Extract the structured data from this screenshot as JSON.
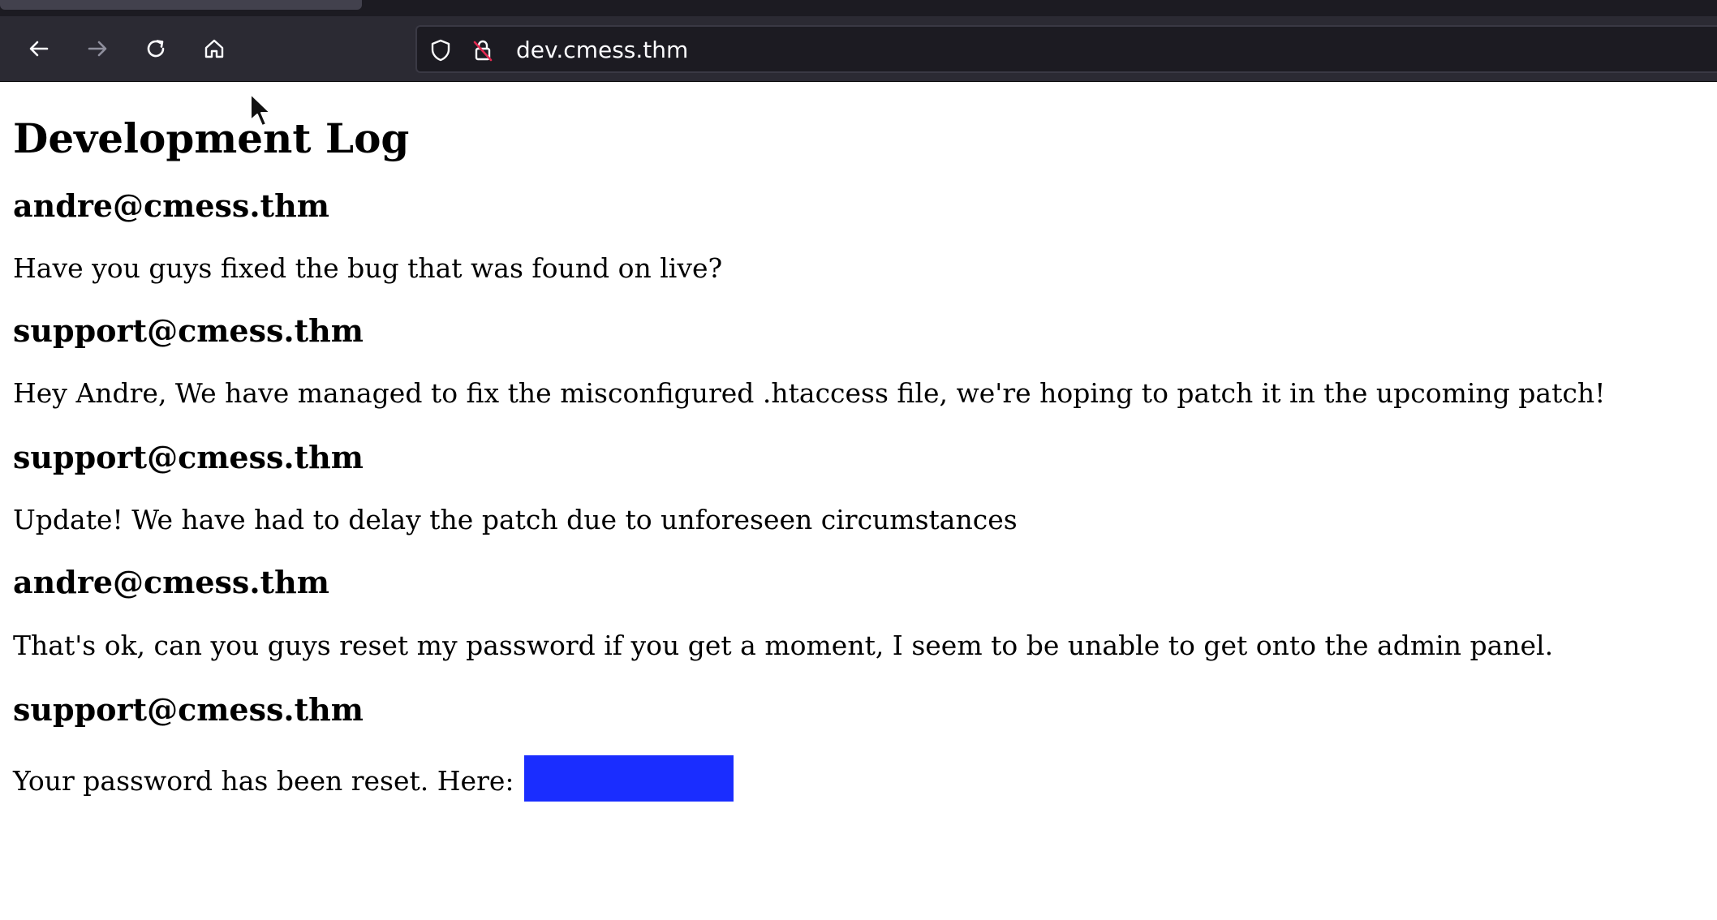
{
  "browser": {
    "url": "dev.cmess.thm",
    "nav_icons": [
      "back-arrow-icon",
      "forward-arrow-icon",
      "reload-icon",
      "home-icon"
    ],
    "url_icons": [
      "tracking-shield-icon",
      "insecure-lock-icon"
    ]
  },
  "page": {
    "title": "Development Log",
    "entries": [
      {
        "author": "andre@cmess.thm",
        "message": "Have you guys fixed the bug that was found on live?"
      },
      {
        "author": "support@cmess.thm",
        "message": "Hey Andre, We have managed to fix the misconfigured .htaccess file, we're hoping to patch it in the upcoming patch!"
      },
      {
        "author": "support@cmess.thm",
        "message": "Update! We have had to delay the patch due to unforeseen circumstances"
      },
      {
        "author": "andre@cmess.thm",
        "message": "That's ok, can you guys reset my password if you get a moment, I seem to be unable to get onto the admin panel."
      },
      {
        "author": "support@cmess.thm",
        "message": "Your password has been reset. Here: "
      }
    ],
    "redaction_color": "#1a2dff"
  }
}
